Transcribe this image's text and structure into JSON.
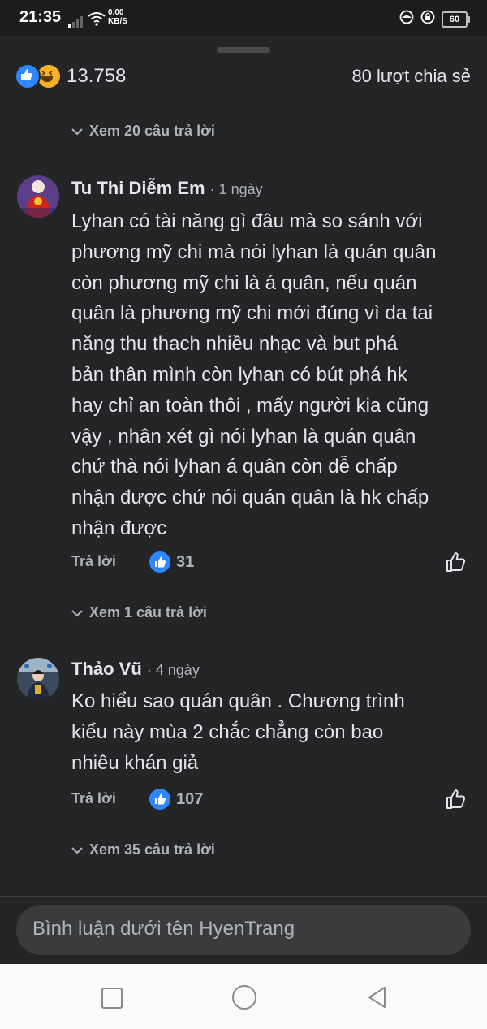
{
  "status_bar": {
    "time": "21:35",
    "net_speed_value": "0.00",
    "net_speed_unit": "KB/S",
    "battery": "60"
  },
  "post_stats": {
    "reaction_count": "13.758",
    "shares": "80 lượt chia sẻ",
    "reaction_icons": [
      "like-icon",
      "haha-icon"
    ]
  },
  "thread": {
    "view_replies_top": "Xem 20 câu trả lời",
    "comments": [
      {
        "author": "Tu Thi Diễm Em",
        "age": "· 1 ngày",
        "text_lines": [
          "Lyhan có tài năng gì đâu mà so sánh với",
          "phương mỹ chi mà nói lyhan là quán quân",
          "còn phương mỹ chi là á quân, nếu quán",
          "quân là phương mỹ chi mới đúng vì da tai",
          "năng thu thach nhiều nhạc và but phá",
          "bản thân mình còn lyhan có bút phá hk",
          "hay chỉ an toàn thôi , mấy người kia cũng",
          "vậy , nhân xét gì nói lyhan là quán quân",
          "chứ thà nói lyhan á quân còn dễ chấp",
          "nhận được chứ nói quán quân là hk chấp",
          "nhận được"
        ],
        "reply_label": "Trả lời",
        "like_count": "31",
        "view_replies": "Xem 1 câu trả lời"
      },
      {
        "author": "Thảo Vũ",
        "age": "· 4 ngày",
        "text_lines": [
          "Ko hiểu sao quán quân . Chương trình",
          "kiểu này mùa 2 chắc chẳng còn bao",
          "nhiêu  khán giả"
        ],
        "reply_label": "Trả lời",
        "like_count": "107",
        "view_replies": "Xem 35 câu trả lời"
      }
    ]
  },
  "composer": {
    "placeholder": "Bình luận dưới tên HyenTrang"
  },
  "colors": {
    "background": "#242526",
    "accent_blue": "#2d88ff",
    "secondary_text": "#b0b3b8",
    "input_bg": "#3a3b3c"
  }
}
